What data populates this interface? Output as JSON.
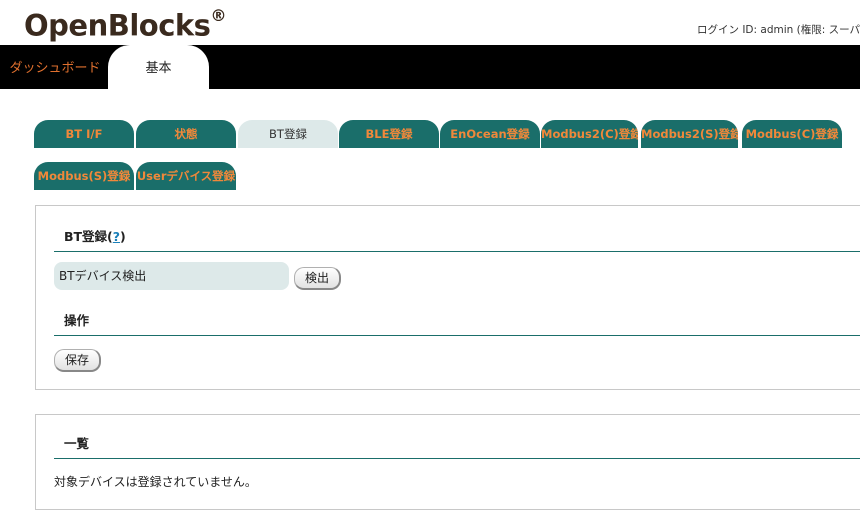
{
  "header": {
    "logo_text": "OpenBlocks",
    "logo_mark": "®",
    "login_info": "ログイン ID: admin (権限: スーパ"
  },
  "topnav": {
    "items": [
      {
        "label": "ダッシュボード",
        "active": false
      },
      {
        "label": "基本",
        "active": true
      }
    ]
  },
  "tabs": [
    {
      "label": "BT I/F",
      "active": false
    },
    {
      "label": "状態",
      "active": false
    },
    {
      "label": "BT登録",
      "active": true
    },
    {
      "label": "BLE登録",
      "active": false
    },
    {
      "label": "EnOcean登録",
      "active": false
    },
    {
      "label": "Modbus2(C)登録",
      "active": false
    },
    {
      "label": "Modbus2(S)登録",
      "active": false
    },
    {
      "label": "Modbus(C)登録",
      "active": false
    },
    {
      "label": "Modbus(S)登録",
      "active": false
    },
    {
      "label": "Userデバイス登録",
      "active": false
    }
  ],
  "bt_register": {
    "title": "BT登録(",
    "help": "?",
    "title_end": ")",
    "detect_input_value": "BTデバイス検出",
    "detect_button": "検出",
    "ops_title": "操作",
    "save_button": "保存"
  },
  "list": {
    "title": "一覧",
    "empty_message": "対象デバイスは登録されていません。"
  },
  "colors": {
    "tab_bg": "#1a6e6a",
    "tab_text": "#f0883a",
    "active_tab_bg": "#dde9e9",
    "nav_bg": "#000000",
    "dashboard_text": "#e0702e"
  }
}
